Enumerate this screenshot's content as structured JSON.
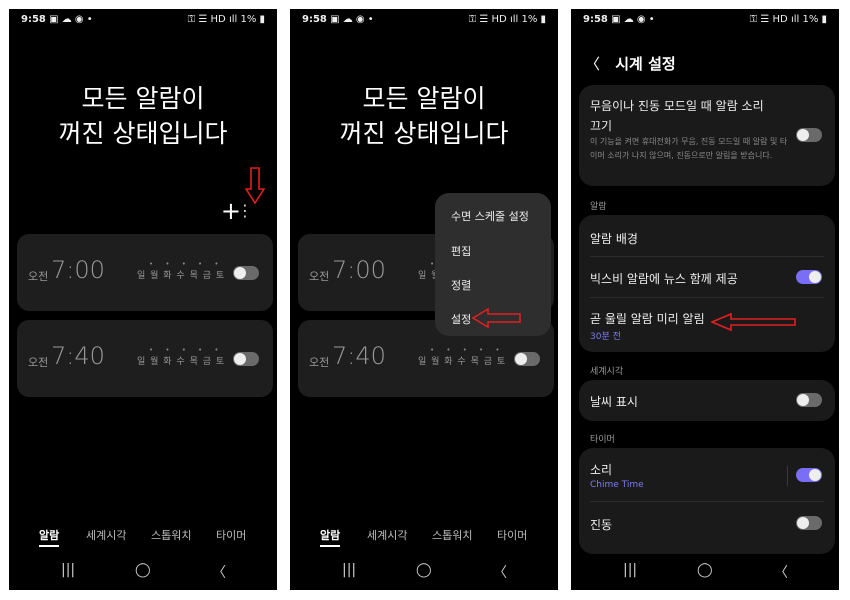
{
  "status": {
    "time": "9:58",
    "left_icons": "▣ ☁ ◉ •",
    "right_icons": "⚿ ☰ HD ıll 1% ▮"
  },
  "alarm_screen": {
    "headline_line1": "모든 알람이",
    "headline_line2": "꺼진 상태입니다",
    "add_icon": "+",
    "more_icon": "⋮",
    "alarms": [
      {
        "ampm": "오전",
        "time": "7:00",
        "days": "일 월 화 수 목 금 토",
        "dots": "• • • • •",
        "enabled": false
      },
      {
        "ampm": "오전",
        "time": "7:40",
        "days": "일 월 화 수 목 금 토",
        "dots": "• • • • •",
        "enabled": false
      }
    ],
    "tabs": [
      "알람",
      "세계시각",
      "스톱워치",
      "타이머"
    ],
    "active_tab": "알람"
  },
  "menu": {
    "items": [
      "수면 스케줄 설정",
      "편집",
      "정렬",
      "설정"
    ]
  },
  "nav": {
    "recent": "|||",
    "home": "◯",
    "back": "〈"
  },
  "settings": {
    "back_icon": "〈",
    "title": "시계 설정",
    "mute_title_line1": "무음이나 진동 모드일 때 알람 소리",
    "mute_title_line2": "끄기",
    "mute_desc": "이 기능을 켜면 휴대전화가 무음, 진동 모드일 때 알람 및 타이머 소리가 나지 않으며, 진동으로만 알림을 받습니다.",
    "mute_enabled": false,
    "section_alarm": "알람",
    "alarm_background": "알람 배경",
    "bixby_news": "빅스비 알람에 뉴스 함께 제공",
    "bixby_enabled": true,
    "upcoming_alarm": "곧 울릴 알람 미리 알림",
    "upcoming_sub": "30분 전",
    "section_world": "세계시각",
    "weather": "날씨 표시",
    "weather_enabled": false,
    "section_timer": "타이머",
    "sound": "소리",
    "sound_sub": "Chime Time",
    "sound_enabled": true,
    "vibration": "진동",
    "vibration_enabled": false
  },
  "colors": {
    "accent": "#7b6ef6",
    "arrow_red": "#e02020",
    "card_bg": "#1e1e1e"
  }
}
